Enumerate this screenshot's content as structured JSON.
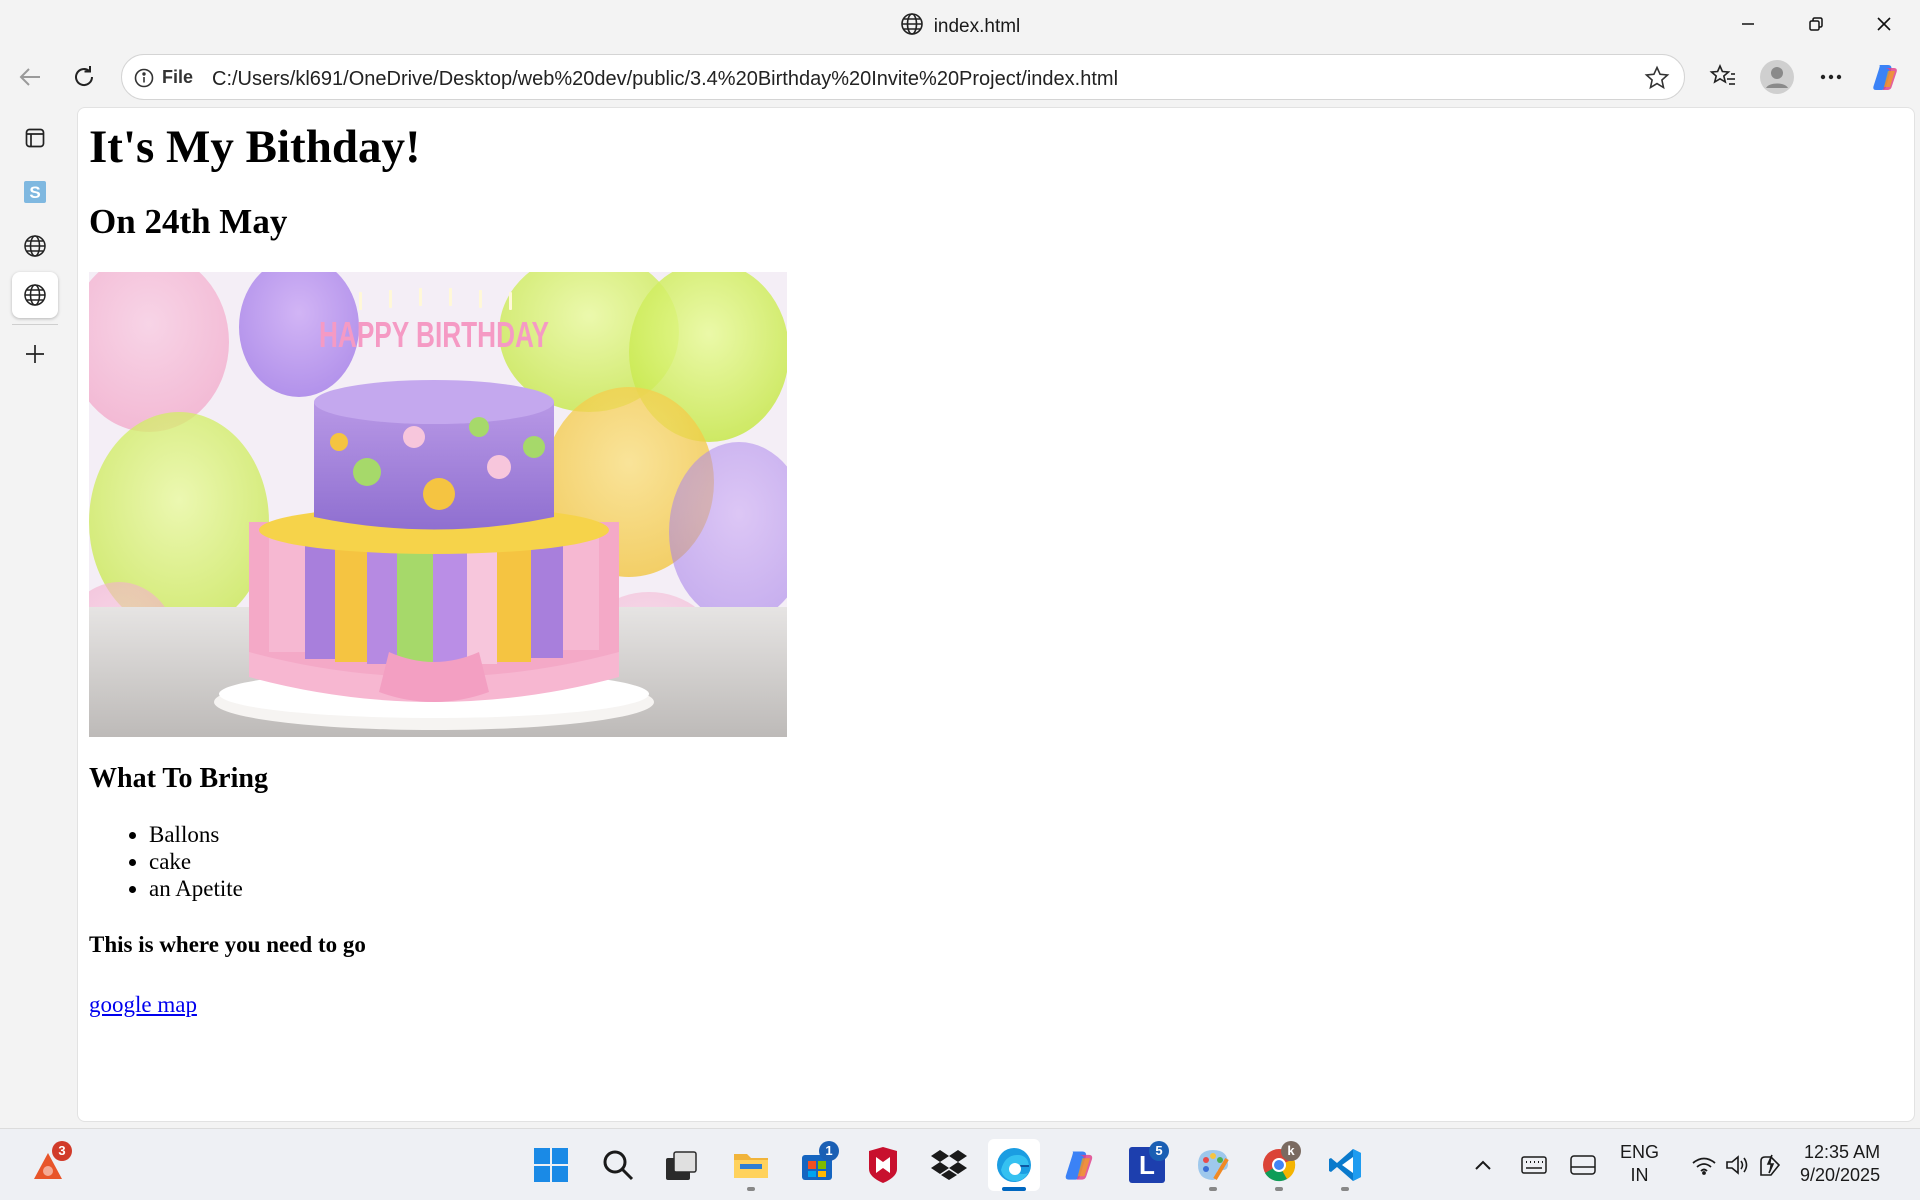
{
  "window": {
    "title": "index.html"
  },
  "toolbar": {
    "info_label": "File",
    "url": "C:/Users/kl691/OneDrive/Desktop/web%20dev/public/3.4%20Birthday%20Invite%20Project/index.html"
  },
  "page": {
    "heading": "It's My Bithday!",
    "date": "On 24th May",
    "cake_text": "HAPPY BIRTHDAY",
    "bring_heading": "What To Bring",
    "bring_items": [
      "Ballons",
      "cake",
      "an Apetite"
    ],
    "directions": "This is where you need to go",
    "map_link": "google map"
  },
  "taskbar": {
    "notification_count": "3",
    "store_badge": "1",
    "l_badge": "5",
    "l_label": "L",
    "chrome_profile": "k",
    "lang_line1": "ENG",
    "lang_line2": "IN",
    "time": "12:35 AM",
    "date": "9/20/2025"
  },
  "colors": {
    "link": "#0000ee",
    "accent": "#0067c0",
    "badge": "#1a5fb4"
  }
}
